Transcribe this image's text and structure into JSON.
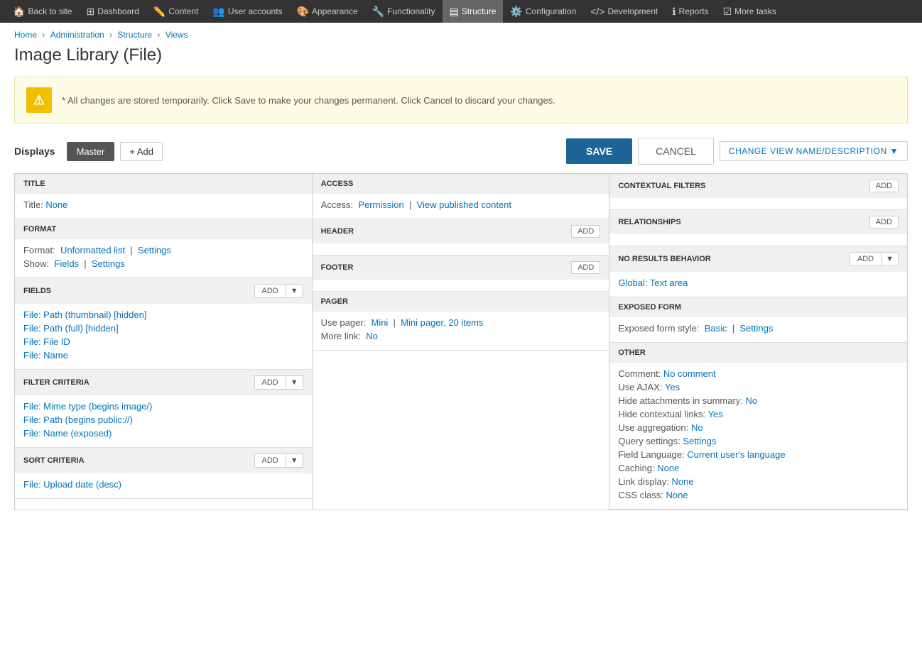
{
  "nav": {
    "items": [
      {
        "label": "Back to site",
        "icon": "🏠",
        "active": false
      },
      {
        "label": "Dashboard",
        "icon": "⊞",
        "active": false
      },
      {
        "label": "Content",
        "icon": "✏️",
        "active": false
      },
      {
        "label": "User accounts",
        "icon": "👥",
        "active": false
      },
      {
        "label": "Appearance",
        "icon": "🎨",
        "active": false
      },
      {
        "label": "Functionality",
        "icon": "🔧",
        "active": false
      },
      {
        "label": "Structure",
        "icon": "▤",
        "active": true
      },
      {
        "label": "Configuration",
        "icon": "⚙️",
        "active": false
      },
      {
        "label": "Development",
        "icon": "</>",
        "active": false
      },
      {
        "label": "Reports",
        "icon": "ℹ",
        "active": false
      },
      {
        "label": "More tasks",
        "icon": "☑",
        "active": false
      }
    ]
  },
  "breadcrumb": {
    "items": [
      "Home",
      "Administration",
      "Structure",
      "Views"
    ]
  },
  "page": {
    "title": "Image Library (File)"
  },
  "warning": {
    "text": "* All changes are stored temporarily. Click Save to make your changes permanent. Click Cancel to discard your changes."
  },
  "toolbar": {
    "displays_label": "Displays",
    "master_label": "Master",
    "add_label": "+ Add",
    "save_label": "SAVE",
    "cancel_label": "CANCEL",
    "change_view_label": "CHANGE VIEW NAME/DESCRIPTION"
  },
  "col1": {
    "title_section": {
      "header": "TITLE",
      "title_label": "Title:",
      "title_value": "None"
    },
    "format_section": {
      "header": "FORMAT",
      "format_label": "Format:",
      "format_link": "Unformatted list",
      "separator": "|",
      "settings_link": "Settings",
      "show_label": "Show:",
      "fields_link": "Fields",
      "show_sep": "|",
      "show_settings_link": "Settings"
    },
    "fields_section": {
      "header": "FIELDS",
      "add_label": "ADD",
      "items": [
        "File: Path (thumbnail) [hidden]",
        "File: Path (full) [hidden]",
        "File: File ID",
        "File: Name"
      ]
    },
    "filter_section": {
      "header": "FILTER CRITERIA",
      "add_label": "ADD",
      "items": [
        "File: Mime type (begins image/)",
        "File: Path (begins public://)",
        "File: Name (exposed)"
      ]
    },
    "sort_section": {
      "header": "SORT CRITERIA",
      "add_label": "ADD",
      "items": [
        "File: Upload date (desc)"
      ]
    }
  },
  "col2": {
    "access_section": {
      "header": "ACCESS",
      "access_label": "Access:",
      "permission_link": "Permission",
      "separator": "|",
      "view_published_link": "View published content"
    },
    "header_section": {
      "header": "HEADER",
      "add_label": "ADD"
    },
    "footer_section": {
      "header": "FOOTER",
      "add_label": "ADD"
    },
    "pager_section": {
      "header": "PAGER",
      "use_pager_label": "Use pager:",
      "mini_link": "Mini",
      "separator": "|",
      "mini_pager_link": "Mini pager, 20 items",
      "more_link_label": "More link:",
      "no_value": "No"
    }
  },
  "col3": {
    "contextual_filters": {
      "header": "CONTEXTUAL FILTERS",
      "add_label": "ADD"
    },
    "relationships": {
      "header": "RELATIONSHIPS",
      "add_label": "ADD"
    },
    "no_results": {
      "header": "NO RESULTS BEHAVIOR",
      "add_label": "ADD",
      "global_link": "Global: Text area"
    },
    "exposed_form": {
      "header": "EXPOSED FORM",
      "style_label": "Exposed form style:",
      "basic_link": "Basic",
      "separator": "|",
      "settings_link": "Settings"
    },
    "other": {
      "header": "OTHER",
      "rows": [
        {
          "label": "Comment:",
          "value": "No comment",
          "is_link": true
        },
        {
          "label": "Use AJAX:",
          "value": "Yes",
          "is_link": true
        },
        {
          "label": "Hide attachments in summary:",
          "value": "No",
          "is_link": true
        },
        {
          "label": "Hide contextual links:",
          "value": "Yes",
          "is_link": true
        },
        {
          "label": "Use aggregation:",
          "value": "No",
          "is_link": true
        },
        {
          "label": "Query settings:",
          "value": "Settings",
          "is_link": true
        },
        {
          "label": "Field Language:",
          "value": "Current user's language",
          "is_link": true
        },
        {
          "label": "Caching:",
          "value": "None",
          "is_link": true
        },
        {
          "label": "Link display:",
          "value": "None",
          "is_link": true
        },
        {
          "label": "CSS class:",
          "value": "None",
          "is_link": true
        }
      ]
    }
  }
}
